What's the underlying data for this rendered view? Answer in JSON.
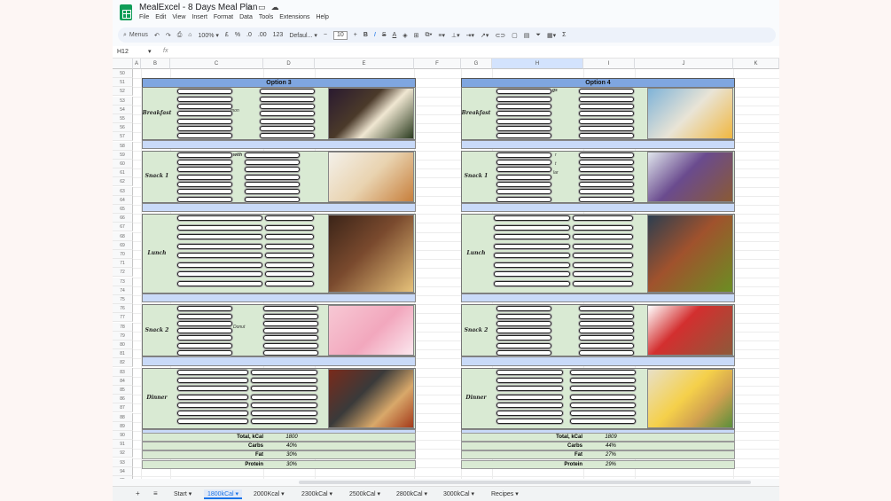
{
  "app": {
    "title": "MealExcel - 8 Days Meal Plan",
    "menus": [
      "File",
      "Edit",
      "View",
      "Insert",
      "Format",
      "Data",
      "Tools",
      "Extensions",
      "Help"
    ]
  },
  "toolbar": {
    "search_label": "Menus",
    "zoom": "100%",
    "currency": "£",
    "percent": "%",
    "dec_decrease": ".0",
    "dec_increase": ".00",
    "number_format": "123",
    "font": "Defaul...",
    "font_size": "10",
    "bold": "B",
    "italic": "I",
    "strike": "S",
    "text_color": "A",
    "functions": "Σ"
  },
  "formula_bar": {
    "cell_ref": "H12",
    "fx": "fx"
  },
  "columns": [
    "A",
    "B",
    "C",
    "D",
    "E",
    "F",
    "G",
    "H",
    "I",
    "J",
    "K"
  ],
  "rows": [
    "50",
    "51",
    "52",
    "53",
    "54",
    "55",
    "56",
    "57",
    "58",
    "59",
    "60",
    "61",
    "62",
    "63",
    "64",
    "65",
    "66",
    "67",
    "68",
    "69",
    "70",
    "71",
    "72",
    "73",
    "74",
    "75",
    "76",
    "77",
    "78",
    "79",
    "80",
    "81",
    "82",
    "83",
    "84",
    "85",
    "86",
    "87",
    "88",
    "89",
    "90",
    "91",
    "92",
    "93",
    "94",
    "95"
  ],
  "option3": {
    "title": "Option 3",
    "meals": [
      "Breakfast",
      "Snack 1",
      "Lunch",
      "Snack 2",
      "Dinner"
    ],
    "fragments": {
      "breakfast": "mon",
      "snack1": "with",
      "snack2": "Donut"
    },
    "summary": [
      {
        "label": "Total, kCal",
        "value": "1800"
      },
      {
        "label": "Carbs",
        "value": "40%"
      },
      {
        "label": "Fat",
        "value": "30%"
      },
      {
        "label": "Protein",
        "value": "30%"
      }
    ]
  },
  "option4": {
    "title": "Option 4",
    "meals": [
      "Breakfast",
      "Snack 1",
      "Lunch",
      "Snack 2",
      "Dinner"
    ],
    "fragments": {
      "breakfast": "gs",
      "snack1_a": "r",
      "snack1_b": "t",
      "snack1_c": "lar"
    },
    "summary": [
      {
        "label": "Total, kCal",
        "value": "1809"
      },
      {
        "label": "Carbs",
        "value": "44%"
      },
      {
        "label": "Fat",
        "value": "27%"
      },
      {
        "label": "Protein",
        "value": "29%"
      }
    ]
  },
  "sheet_tabs": [
    "Start",
    "1800kCal",
    "2000Kcal",
    "2300kCal",
    "2500kCal",
    "2800kCal",
    "3000kCal",
    "Recipes"
  ],
  "active_tab": "1800kCal",
  "colors": {
    "header": "#7fa6e0",
    "section": "#d9ead3",
    "separator": "#c9daf8",
    "accent": "#1a73e8"
  }
}
